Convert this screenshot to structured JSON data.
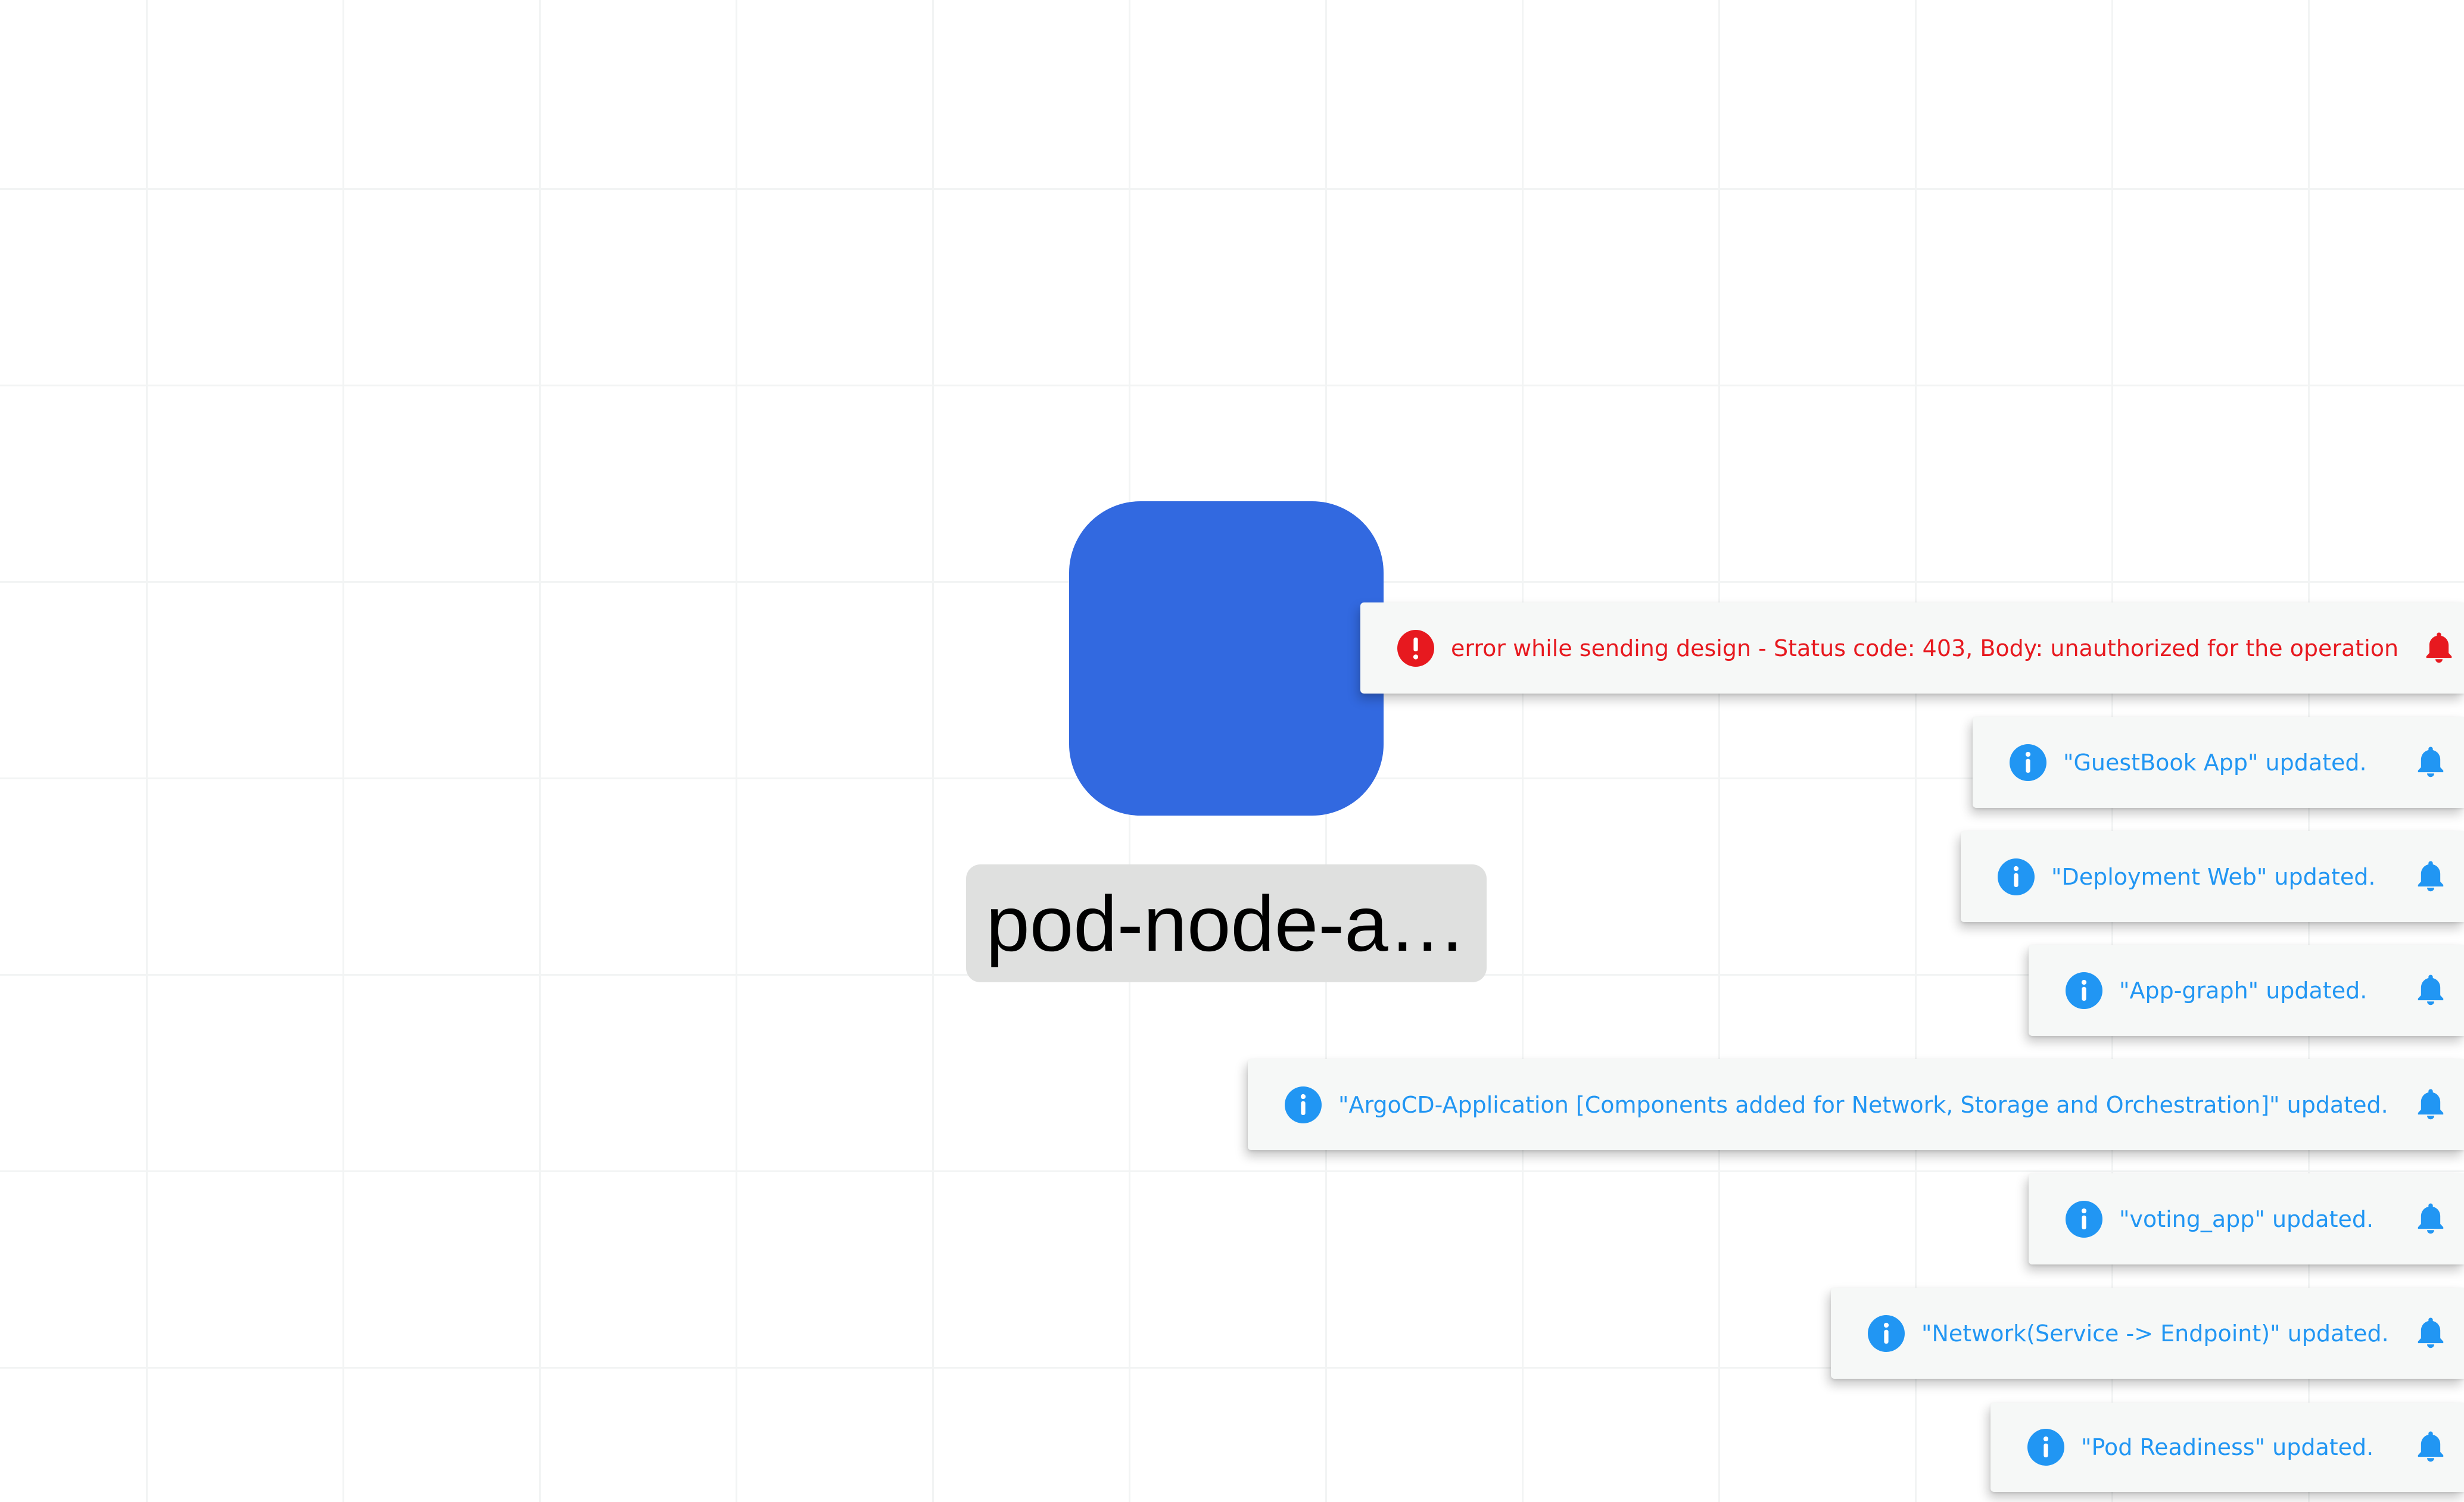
{
  "canvas": {
    "node": {
      "label": "pod-node-a…",
      "color": "#3269e0"
    }
  },
  "notifications": [
    {
      "type": "error",
      "message": "error while sending design - Status code: 403, Body: unauthorized for the operation",
      "status_icon": "error-circle-icon",
      "action_icon": "bell-icon",
      "color": "#e7191f"
    },
    {
      "type": "info",
      "message": "\"GuestBook App\" updated.",
      "status_icon": "info-circle-icon",
      "action_icon": "bell-icon",
      "color": "#2196f3"
    },
    {
      "type": "info",
      "message": "\"Deployment Web\" updated.",
      "status_icon": "info-circle-icon",
      "action_icon": "bell-icon",
      "color": "#2196f3"
    },
    {
      "type": "info",
      "message": "\"App-graph\" updated.",
      "status_icon": "info-circle-icon",
      "action_icon": "bell-icon",
      "color": "#2196f3"
    },
    {
      "type": "info",
      "message": "\"ArgoCD-Application [Components added for Network, Storage and Orchestration]\" updated.",
      "status_icon": "info-circle-icon",
      "action_icon": "bell-icon",
      "color": "#2196f3"
    },
    {
      "type": "info",
      "message": "\"voting_app\" updated.",
      "status_icon": "info-circle-icon",
      "action_icon": "bell-icon",
      "color": "#2196f3"
    },
    {
      "type": "info",
      "message": "\"Network(Service -> Endpoint)\" updated.",
      "status_icon": "info-circle-icon",
      "action_icon": "bell-icon",
      "color": "#2196f3"
    },
    {
      "type": "info",
      "message": "\"Pod Readiness\" updated.",
      "status_icon": "info-circle-icon",
      "action_icon": "bell-icon",
      "color": "#2196f3"
    }
  ]
}
